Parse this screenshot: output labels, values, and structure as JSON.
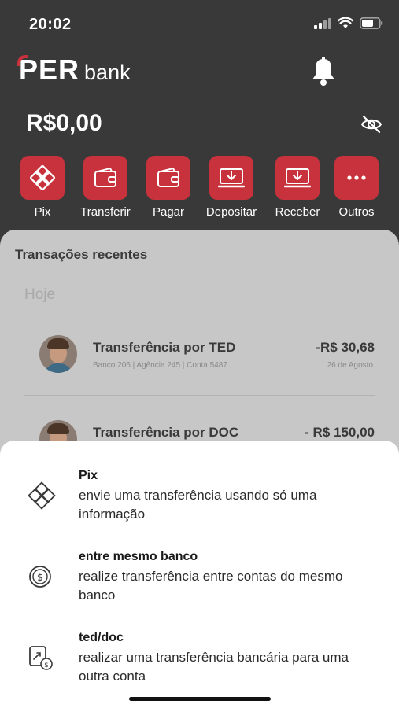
{
  "status": {
    "time": "20:02"
  },
  "header": {
    "logo_main": "PER",
    "logo_sub": "bank",
    "balance": "R$0,00"
  },
  "actions": [
    {
      "label": "Pix",
      "icon": "pix-icon"
    },
    {
      "label": "Transferir",
      "icon": "wallet-icon"
    },
    {
      "label": "Pagar",
      "icon": "wallet-icon"
    },
    {
      "label": "Depositar",
      "icon": "deposit-icon"
    },
    {
      "label": "Receber",
      "icon": "deposit-icon"
    },
    {
      "label": "Outros",
      "icon": "more-icon"
    }
  ],
  "recent": {
    "title": "Transações recentes",
    "day": "Hoje",
    "transactions": [
      {
        "title": "Transferência por TED",
        "subtitle": "Banco 206 | Agência 245 | Conta 5487",
        "amount": "-R$ 30,68",
        "date": "26 de Agosto"
      },
      {
        "title": "Transferência por DOC",
        "amount": "- R$ 150,00"
      }
    ]
  },
  "sheet": {
    "options": [
      {
        "title": "Pix",
        "description": "envie uma transferência usando só uma informação",
        "icon": "pix-icon"
      },
      {
        "title": "entre mesmo banco",
        "description": "realize transferência entre contas do mesmo banco",
        "icon": "dollar-coin-icon"
      },
      {
        "title": "ted/doc",
        "description": "realizar uma transferência bancária para uma outra conta",
        "icon": "transfer-doc-icon"
      }
    ]
  },
  "colors": {
    "accent": "#c8323c",
    "header_bg": "#3a3939",
    "panel_bg": "#c7c7c7"
  }
}
